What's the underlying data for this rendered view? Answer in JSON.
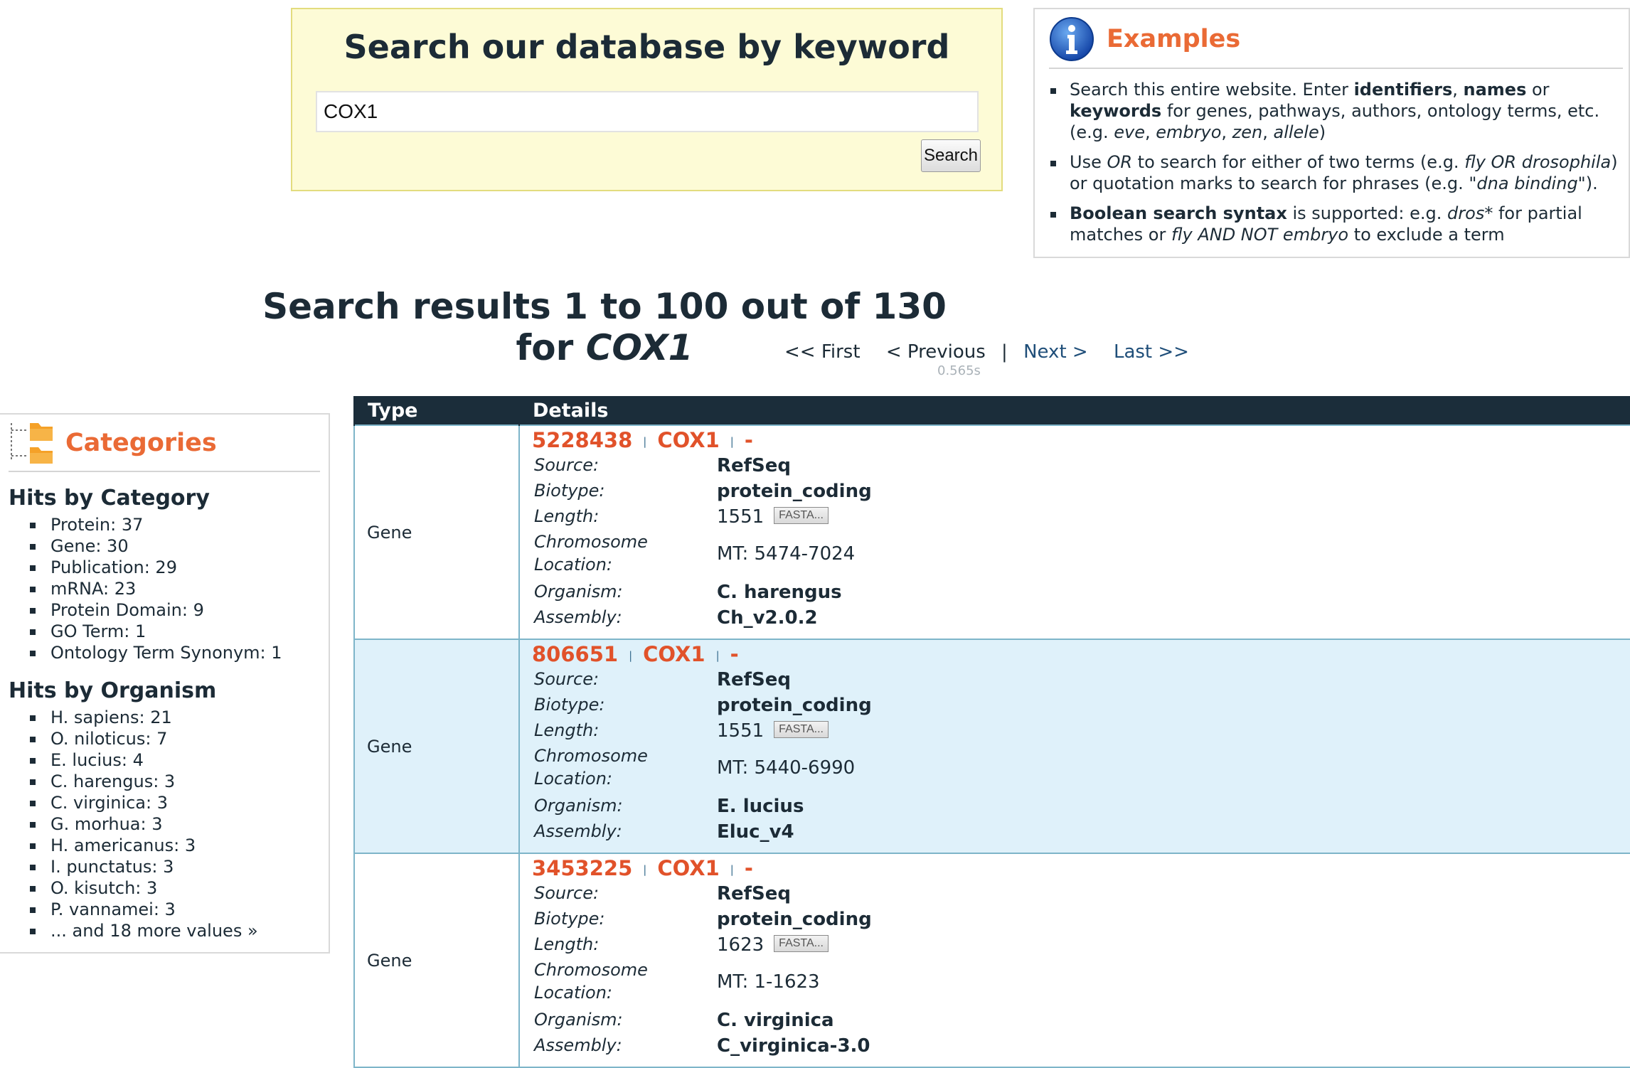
{
  "search": {
    "title": "Search our database by keyword",
    "input_value": "COX1",
    "button_label": "Search"
  },
  "examples": {
    "title": "Examples",
    "items": [
      "Search this entire website. Enter identifiers, names or keywords for genes, pathways, authors, ontology terms, etc. (e.g. eve, embryo, zen, allele)",
      "Use OR to search for either of two terms (e.g. fly OR drosophila) or quotation marks to search for phrases (e.g. \"dna binding\").",
      "Boolean search syntax is supported: e.g. dros* for partial matches or fly AND NOT embryo to exclude a term"
    ]
  },
  "results": {
    "title_prefix": "Search results 1 to 100 out of 130 for",
    "query": "COX1",
    "pager": {
      "first": "<< First",
      "previous": "< Previous",
      "separator": "|",
      "next": "Next >",
      "last": "Last >>"
    },
    "timing": "0.565s"
  },
  "categories": {
    "title": "Categories",
    "by_category_heading": "Hits by Category",
    "by_category": [
      "Protein: 37",
      "Gene: 30",
      "Publication: 29",
      "mRNA: 23",
      "Protein Domain: 9",
      "GO Term: 1",
      "Ontology Term Synonym: 1"
    ],
    "by_organism_heading": "Hits by Organism",
    "by_organism": [
      "H. sapiens: 21",
      "O. niloticus: 7",
      "E. lucius: 4",
      "C. harengus: 3",
      "C. virginica: 3",
      "G. morhua: 3",
      "H. americanus: 3",
      "I. punctatus: 3",
      "O. kisutch: 3",
      "P. vannamei: 3"
    ],
    "more_values": "... and 18 more values »"
  },
  "table": {
    "headers": {
      "type": "Type",
      "details": "Details"
    },
    "labels": {
      "source": "Source:",
      "biotype": "Biotype:",
      "length": "Length:",
      "chromosome_location": "Chromosome Location:",
      "organism": "Organism:",
      "assembly": "Assembly:",
      "fasta": "FASTA..."
    },
    "rows": [
      {
        "type": "Gene",
        "id": "5228438",
        "symbol": "COX1",
        "name": "-",
        "source": "RefSeq",
        "biotype": "protein_coding",
        "length": "1551",
        "location": "MT: 5474-7024",
        "organism": "C. harengus",
        "assembly": "Ch_v2.0.2"
      },
      {
        "type": "Gene",
        "id": "806651",
        "symbol": "COX1",
        "name": "-",
        "source": "RefSeq",
        "biotype": "protein_coding",
        "length": "1551",
        "location": "MT: 5440-6990",
        "organism": "E. lucius",
        "assembly": "Eluc_v4"
      },
      {
        "type": "Gene",
        "id": "3453225",
        "symbol": "COX1",
        "name": "-",
        "source": "RefSeq",
        "biotype": "protein_coding",
        "length": "1623",
        "location": "MT: 1-1623",
        "organism": "C. virginica",
        "assembly": "C_virginica-3.0"
      }
    ]
  },
  "colors": {
    "accent_orange": "#ea6a35",
    "result_id_red": "#e1522a",
    "table_header_bg": "#1b2d3a",
    "row_alt_bg": "#dff1fa",
    "search_panel_bg": "#fdfbd6"
  }
}
